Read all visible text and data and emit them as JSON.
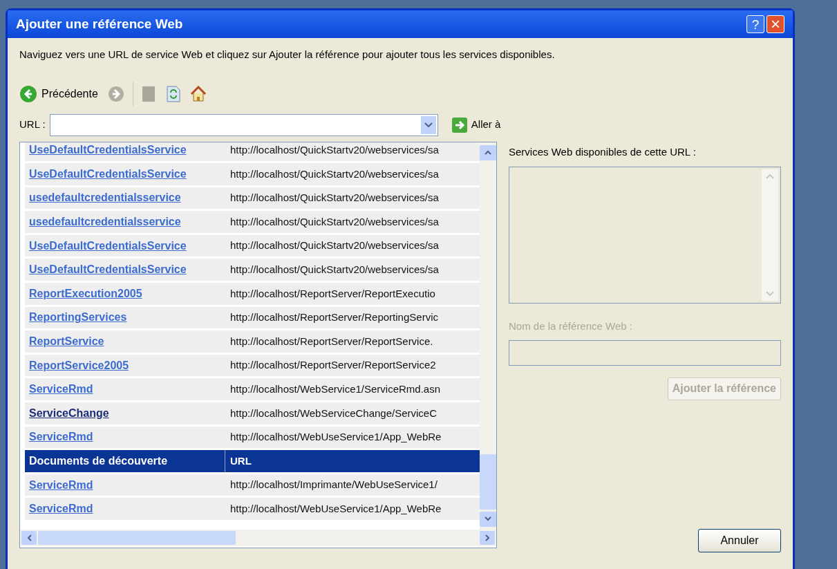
{
  "window": {
    "title": "Ajouter une référence Web",
    "buttons": [
      "?",
      "×"
    ]
  },
  "instruction": "Naviguez vers une URL de service Web et cliquez sur Ajouter la référence pour ajouter tous les services disponibles.",
  "toolbar": {
    "back_label": "Précédente",
    "forward_disabled": true
  },
  "url_field": {
    "label": "URL :"
  },
  "go_button": "Aller à",
  "results": [
    {
      "kind": "link",
      "name": "UseDefaultCredentialsService",
      "url": "http://localhost/QuickStartv20/webservices/sa",
      "visited": false
    },
    {
      "kind": "link",
      "name": "UseDefaultCredentialsService",
      "url": "http://localhost/QuickStartv20/webservices/sa",
      "visited": false
    },
    {
      "kind": "link",
      "name": "usedefaultcredentialsservice",
      "url": "http://localhost/QuickStartv20/webservices/sa",
      "visited": false
    },
    {
      "kind": "link",
      "name": "usedefaultcredentialsservice",
      "url": "http://localhost/QuickStartv20/webservices/sa",
      "visited": false
    },
    {
      "kind": "link",
      "name": "UseDefaultCredentialsService",
      "url": "http://localhost/QuickStartv20/webservices/sa",
      "visited": false
    },
    {
      "kind": "link",
      "name": "UseDefaultCredentialsService",
      "url": "http://localhost/QuickStartv20/webservices/sa",
      "visited": false
    },
    {
      "kind": "link",
      "name": "ReportExecution2005",
      "url": "http://localhost/ReportServer/ReportExecutio",
      "visited": false
    },
    {
      "kind": "link",
      "name": "ReportingServices",
      "url": "http://localhost/ReportServer/ReportingServic",
      "visited": false
    },
    {
      "kind": "link",
      "name": "ReportService",
      "url": "http://localhost/ReportServer/ReportService.",
      "visited": false
    },
    {
      "kind": "link",
      "name": "ReportService2005",
      "url": "http://localhost/ReportServer/ReportService2",
      "visited": false
    },
    {
      "kind": "link",
      "name": "ServiceRmd",
      "url": "http://localhost/WebService1/ServiceRmd.asn",
      "visited": false
    },
    {
      "kind": "link",
      "name": "ServiceChange",
      "url": "http://localhost/WebServiceChange/ServiceC",
      "visited": true
    },
    {
      "kind": "link",
      "name": "ServiceRmd",
      "url": "http://localhost/WebUseService1/App_WebRe",
      "visited": false
    },
    {
      "kind": "header",
      "name": "Documents de découverte",
      "url": "URL"
    },
    {
      "kind": "link",
      "name": "ServiceRmd",
      "url": "http://localhost/Imprimante/WebUseService1/",
      "visited": false
    },
    {
      "kind": "link",
      "name": "ServiceRmd",
      "url": "http://localhost/WebUseService1/App_WebRe",
      "visited": false
    }
  ],
  "services_label": "Services Web disponibles de cette URL :",
  "reference_name": {
    "label": "Nom de la référence Web :",
    "disabled": true
  },
  "add_button": {
    "label": "Ajouter la référence",
    "disabled": true
  },
  "cancel_button": "Annuler"
}
